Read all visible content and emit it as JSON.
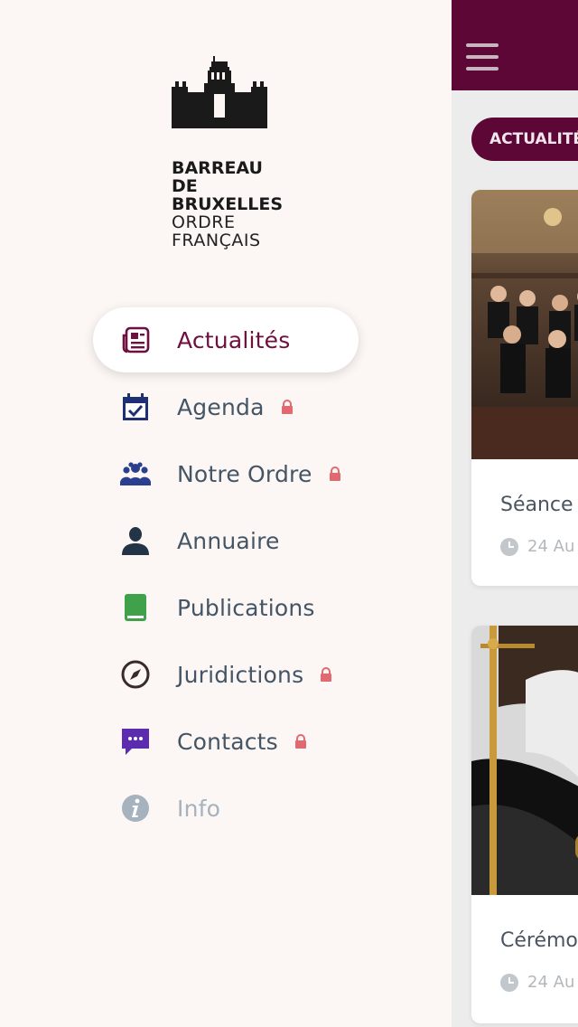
{
  "logo": {
    "line1": "BARREAU",
    "line2": "DE",
    "line3": "BRUXELLES",
    "line4": "ORDRE",
    "line5": "FRANÇAIS"
  },
  "menu": {
    "items": [
      {
        "label": "Actualités",
        "icon": "news-icon",
        "locked": false,
        "active": true
      },
      {
        "label": "Agenda",
        "icon": "calendar-icon",
        "locked": true
      },
      {
        "label": "Notre Ordre",
        "icon": "group-icon",
        "locked": true
      },
      {
        "label": "Annuaire",
        "icon": "person-icon",
        "locked": false
      },
      {
        "label": "Publications",
        "icon": "book-icon",
        "locked": false
      },
      {
        "label": "Juridictions",
        "icon": "compass-icon",
        "locked": true
      },
      {
        "label": "Contacts",
        "icon": "chat-icon",
        "locked": true
      },
      {
        "label": "Info",
        "icon": "info-icon",
        "locked": false,
        "muted": true
      }
    ]
  },
  "main": {
    "chip_label": "ACTUALITÉS",
    "cards": [
      {
        "title": "Séance",
        "date": "24 Au"
      },
      {
        "title": "Cérémo",
        "date": "24 Au"
      }
    ]
  },
  "colors": {
    "brand": "#5c0736",
    "active_text": "#6e0f3f",
    "lock": "#e06a6f"
  }
}
